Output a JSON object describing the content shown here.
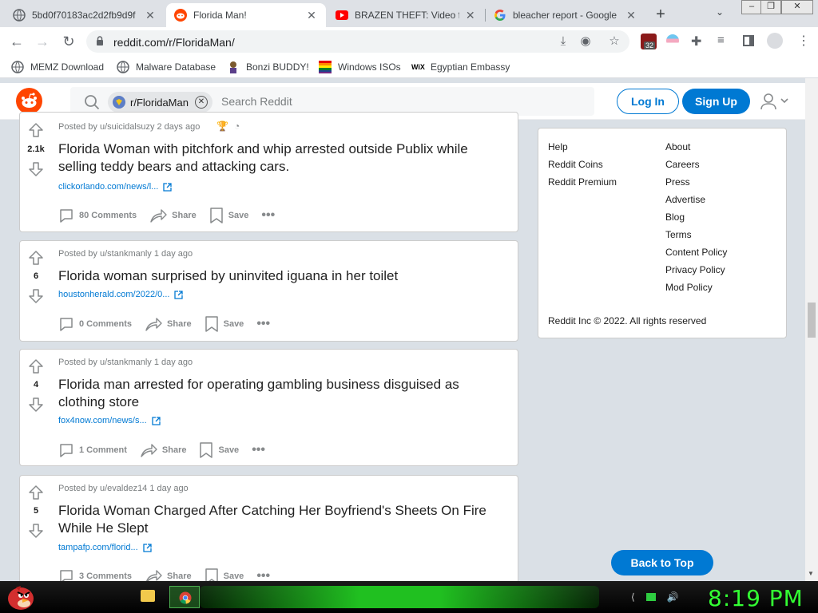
{
  "browser": {
    "tabs": [
      {
        "title": "5bd0f70183ac2d2fb9d9f",
        "favicon": "globe-icon",
        "active": false
      },
      {
        "title": "Florida Man!",
        "favicon": "reddit-icon",
        "active": true
      },
      {
        "title": "BRAZEN THEFT: Video fro",
        "favicon": "youtube-icon",
        "active": false
      },
      {
        "title": "bleacher report - Google",
        "favicon": "google-icon",
        "active": false
      }
    ],
    "url": "reddit.com/r/FloridaMan/",
    "bookmarks": [
      {
        "label": "MEMZ Download",
        "icon": "globe-icon"
      },
      {
        "label": "Malware Database",
        "icon": "globe-icon"
      },
      {
        "label": "Bonzi BUDDY!",
        "icon": "bonzi-icon"
      },
      {
        "label": "Windows ISOs",
        "icon": "windows-icon"
      },
      {
        "label": "Egyptian Embassy",
        "icon": "wix-icon"
      }
    ],
    "extension_badge": "32"
  },
  "reddit": {
    "search_chip": "r/FloridaMan",
    "search_placeholder": "Search Reddit",
    "login": "Log In",
    "signup": "Sign Up"
  },
  "posts": [
    {
      "score": "2.1k",
      "meta": "Posted by u/suicidalsuzy 2 days ago",
      "title": "Florida Woman with pitchfork and whip arrested outside Publix while selling teddy bears and attacking cars.",
      "link": "clickorlando.com/news/l...",
      "comments": "80 Comments",
      "share": "Share",
      "save": "Save"
    },
    {
      "score": "6",
      "meta": "Posted by u/stankmanly 1 day ago",
      "title": "Florida woman surprised by uninvited iguana in her toilet",
      "link": "houstonherald.com/2022/0...",
      "comments": "0 Comments",
      "share": "Share",
      "save": "Save"
    },
    {
      "score": "4",
      "meta": "Posted by u/stankmanly 1 day ago",
      "title": "Florida man arrested for operating gambling business disguised as clothing store",
      "link": "fox4now.com/news/s...",
      "comments": "1 Comment",
      "share": "Share",
      "save": "Save"
    },
    {
      "score": "5",
      "meta": "Posted by u/evaldez14 1 day ago",
      "title": "Florida Woman Charged After Catching Her Boyfriend's Sheets On Fire While He Slept",
      "link": "tampafp.com/florid...",
      "comments": "3 Comments",
      "share": "Share",
      "save": "Save"
    }
  ],
  "sidebar": {
    "left_links": [
      "Help",
      "Reddit Coins",
      "Reddit Premium"
    ],
    "right_links": [
      "About",
      "Careers",
      "Press",
      "Advertise",
      "Blog",
      "Terms",
      "Content Policy",
      "Privacy Policy",
      "Mod Policy"
    ],
    "copyright": "Reddit Inc © 2022. All rights reserved",
    "back_to_top": "Back to Top"
  },
  "taskbar": {
    "clock": "8:19 PM"
  },
  "colors": {
    "reddit_orange": "#ff4500",
    "reddit_blue": "#0079d3",
    "clock_green": "#33ff33"
  }
}
